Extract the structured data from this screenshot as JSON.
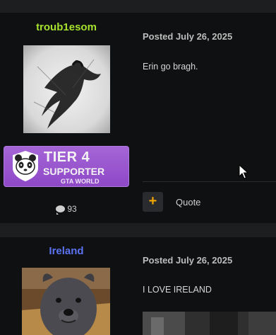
{
  "posts": [
    {
      "username": "troub1esom",
      "username_color": "#a6e22e",
      "posted_label": "Posted July 26, 2025",
      "content": "Erin go bragh.",
      "badge": {
        "tier": "TIER 4",
        "supporter": "SUPPORTER",
        "org": "GTA WORLD",
        "icon": "panda-icon"
      },
      "post_count": "93",
      "actions": {
        "plus_label": "+",
        "quote_label": "Quote"
      }
    },
    {
      "username": "Ireland",
      "username_color": "#5b73f0",
      "posted_label": "Posted July 26, 2025",
      "content": "I LOVE IRELAND"
    }
  ],
  "colors": {
    "accent": "#f0a500",
    "badge_purple": "#9a55cf",
    "background": "#0f1011",
    "separator": "#1d1e20"
  }
}
